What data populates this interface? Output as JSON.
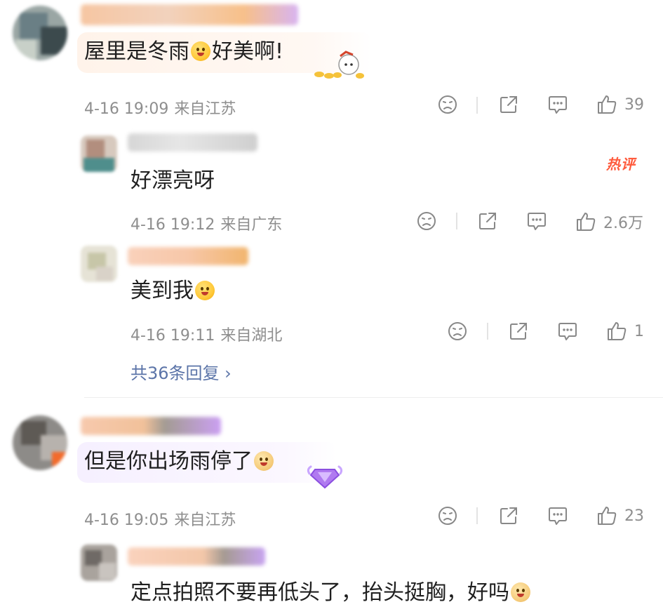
{
  "comments": [
    {
      "text_before": "屋里是冬雨",
      "text_after": "好美啊!",
      "time": "4-16 19:09",
      "location": "来自江苏",
      "likes": "39",
      "replies": [
        {
          "text": "好漂亮呀",
          "time": "4-16 19:12",
          "location": "来自广东",
          "likes": "2.6万",
          "badge": "热评"
        },
        {
          "text": "美到我",
          "time": "4-16 19:11",
          "location": "来自湖北",
          "likes": "1"
        }
      ],
      "more_replies": "共36条回复 ›"
    },
    {
      "text": "但是你出场雨停了",
      "time": "4-16 19:05",
      "location": "来自江苏",
      "likes": "23",
      "replies": [
        {
          "text": "定点拍照不要再低头了，抬头挺胸，好吗"
        }
      ]
    }
  ],
  "icons": {
    "dislike": "dislike-face-icon",
    "share": "share-icon",
    "comment": "comment-icon",
    "like": "thumbs-up-icon"
  },
  "colors": {
    "meta_text": "#8e8e8e",
    "link_blue": "#5b74a8",
    "hot_badge": "#ff5a3c"
  }
}
